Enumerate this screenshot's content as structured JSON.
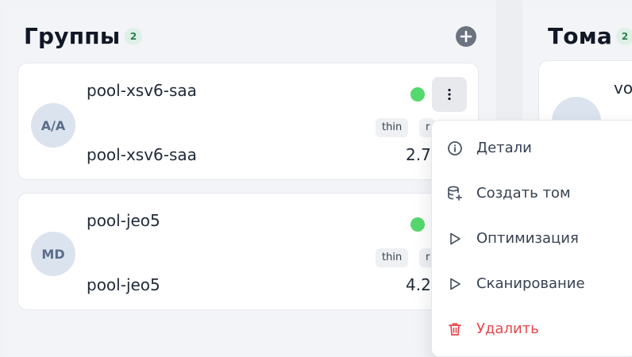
{
  "groups_panel": {
    "title": "Группы",
    "count": "2"
  },
  "volumes_panel": {
    "title": "Тома",
    "count": "2"
  },
  "pools": [
    {
      "initials": "A/A",
      "name": "pool-xsv6-saa",
      "subtitle": "pool-xsv6-saa",
      "tags": [
        "thin",
        "r"
      ],
      "size": "2.7",
      "status": "online"
    },
    {
      "initials": "MD",
      "name": "pool-jeo5",
      "subtitle": "pool-jeo5",
      "tags": [
        "thin",
        "r"
      ],
      "size": "4.2",
      "status": "online"
    }
  ],
  "volume_card": {
    "name": "vo",
    "icon": "database-icon"
  },
  "context_menu": {
    "items": [
      {
        "label": "Детали",
        "icon": "info-icon"
      },
      {
        "label": "Создать том",
        "icon": "database-add-icon"
      },
      {
        "label": "Оптимизация",
        "icon": "play-icon"
      },
      {
        "label": "Сканирование",
        "icon": "play-icon"
      },
      {
        "label": "Удалить",
        "icon": "trash-icon",
        "danger": true
      }
    ]
  },
  "colors": {
    "status_online": "#55d86e",
    "badge_bg": "#dff0e7",
    "badge_text": "#2f7d56",
    "danger": "#e5484d"
  }
}
